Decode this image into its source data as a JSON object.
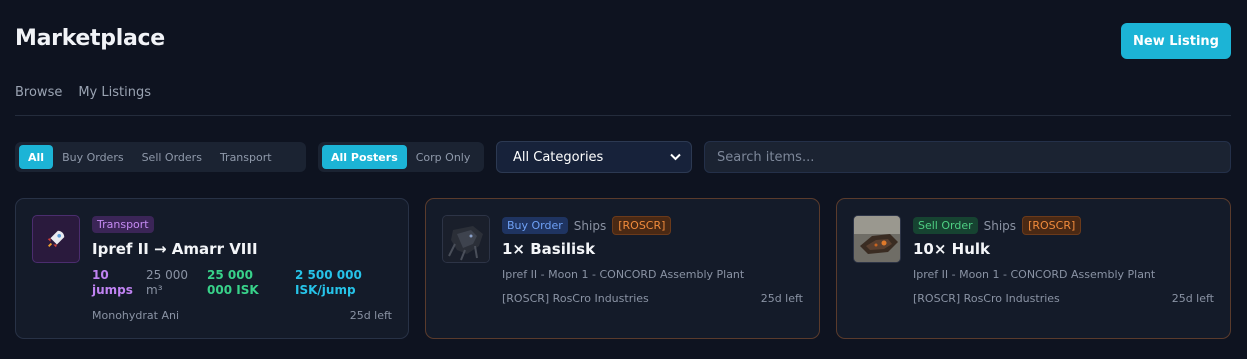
{
  "header": {
    "title": "Marketplace",
    "new_listing_label": "New Listing"
  },
  "tabs": [
    {
      "label": "Browse"
    },
    {
      "label": "My Listings"
    }
  ],
  "filters": {
    "type_options": [
      "All",
      "Buy Orders",
      "Sell Orders",
      "Transport"
    ],
    "type_selected": "All",
    "poster_options": [
      "All Posters",
      "Corp Only"
    ],
    "poster_selected": "All Posters",
    "category_selected": "All Categories",
    "search_placeholder": "Search items..."
  },
  "listings": [
    {
      "type_badge": "Transport",
      "title": "Ipref II → Amarr VIII",
      "stats": {
        "jumps": "10 jumps",
        "volume": "25 000 m³",
        "reward": "25 000 000 ISK",
        "per_jump": "2 500 000 ISK/jump"
      },
      "poster": "Monohydrat Ani",
      "time_left": "25d left",
      "icon": "rocket-icon"
    },
    {
      "type_badge": "Buy Order",
      "category": "Ships",
      "corp_tag": "[ROSCR]",
      "title": "1× Basilisk",
      "location": "Ipref II - Moon 1 - CONCORD Assembly Plant",
      "poster": "[ROSCR] RosCro Industries",
      "time_left": "25d left",
      "icon": "basilisk-ship-image"
    },
    {
      "type_badge": "Sell Order",
      "category": "Ships",
      "corp_tag": "[ROSCR]",
      "title": "10× Hulk",
      "location": "Ipref II - Moon 1 - CONCORD Assembly Plant",
      "poster": "[ROSCR] RosCro Industries",
      "time_left": "25d left",
      "icon": "hulk-ship-image"
    }
  ],
  "colors": {
    "accent": "#1cb4d6",
    "background": "#0e1320",
    "card": "#141b29"
  }
}
